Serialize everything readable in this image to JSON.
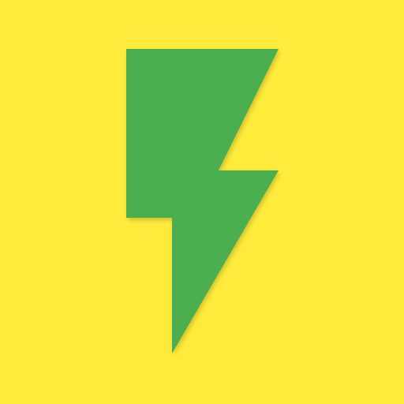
{
  "icon": {
    "name": "lightning-bolt-icon",
    "background_color": "#FFEB3B",
    "bolt_color": "#4CAF50"
  }
}
